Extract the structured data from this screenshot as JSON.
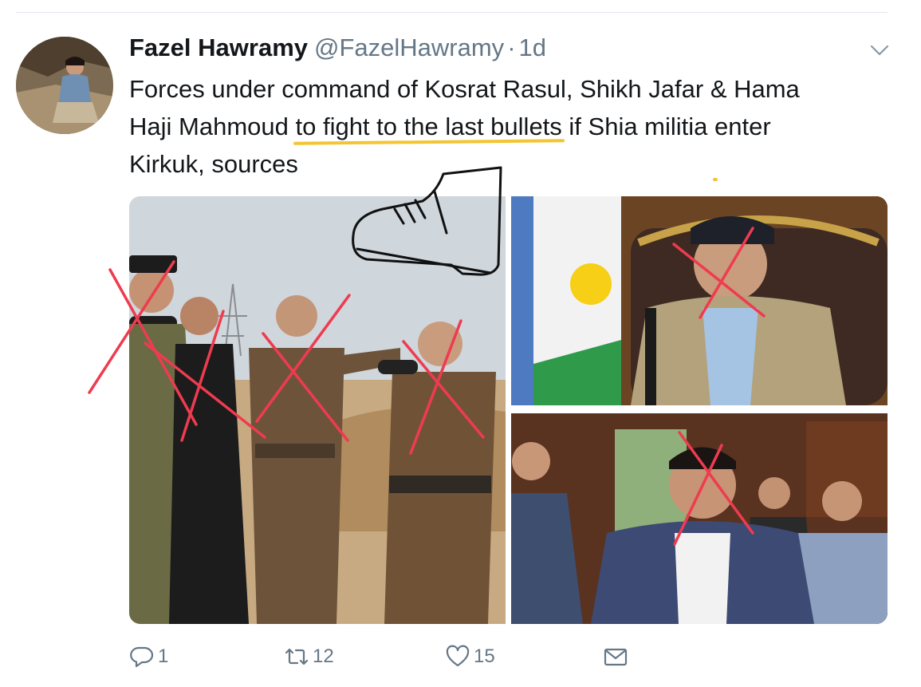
{
  "tweet": {
    "author_name": "Fazel Hawramy",
    "author_handle": "@FazelHawramy",
    "separator": "·",
    "time": "1d",
    "text_part_1": "Forces under command of Kosrat Rasul, Shikh Jafar & Hama Haji Mahmoud ",
    "text_highlight_1": "to fight to the last bullets",
    "text_part_2": " if Shia militia ",
    "text_highlight_2": "enter Kirkuk,",
    "text_part_3": " sources"
  },
  "actions": {
    "reply_count": "1",
    "retweet_count": "12",
    "like_count": "15"
  },
  "icons": {
    "reply": "reply-icon",
    "retweet": "retweet-icon",
    "like": "heart-icon",
    "dm": "envelope-icon",
    "menu": "chevron-down-icon"
  },
  "colors": {
    "secondary_text": "#657786",
    "highlight_underline": "#f2c531",
    "cross_marks": "#ef3b4f",
    "divider": "#e1e8ed"
  }
}
